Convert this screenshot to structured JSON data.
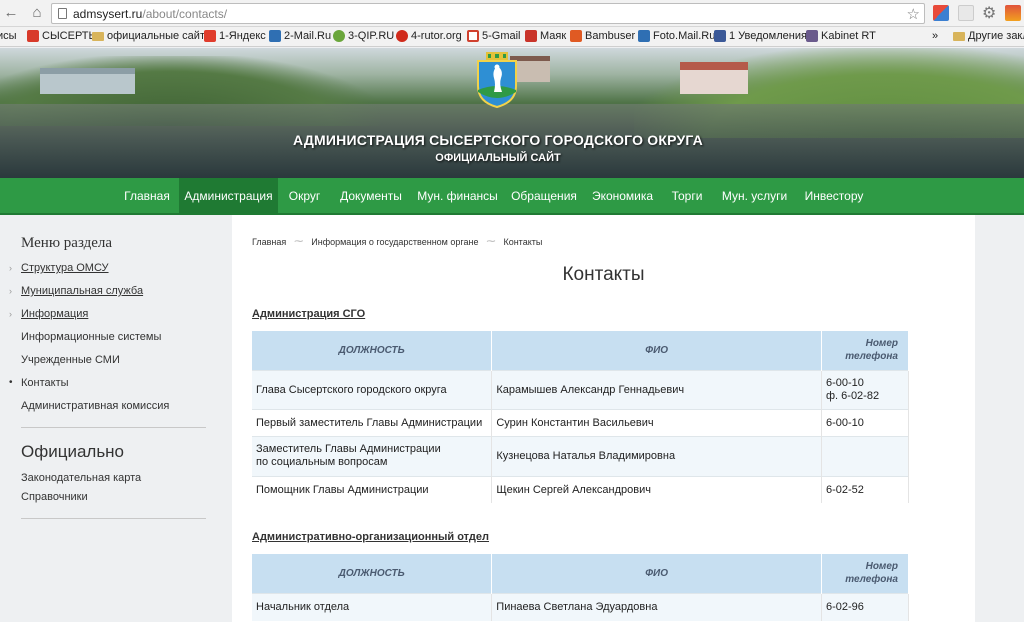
{
  "browser": {
    "url_host": "admsysert.ru",
    "url_path": "/about/contacts/",
    "bookmarks": [
      {
        "label": "исы",
        "color": "#ffffff"
      },
      {
        "label": "СЫСЕРТЬ",
        "color": "#d83a2a"
      },
      {
        "label": "официальные сайты",
        "color": "#d8b45b"
      },
      {
        "label": "1-Яндекс",
        "color": "#e03c2c"
      },
      {
        "label": "2-Mail.Ru",
        "color": "#2f6fb3"
      },
      {
        "label": "3-QIP.RU",
        "color": "#6aa63b"
      },
      {
        "label": "4-rutor.org",
        "color": "#d02a1b"
      },
      {
        "label": "5-Gmail",
        "color": "#d0402e"
      },
      {
        "label": "Маяк",
        "color": "#c9342a"
      },
      {
        "label": "Bambuser",
        "color": "#e05a23"
      },
      {
        "label": "Foto.Mail.Ru",
        "color": "#2f6fb3"
      },
      {
        "label": "1 Уведомления",
        "color": "#3b5998"
      },
      {
        "label": "Kabinet RT",
        "color": "#6a5a8c"
      },
      {
        "label": "»",
        "color": ""
      },
      {
        "label": "Другие закла",
        "color": "#d8b45b"
      }
    ]
  },
  "header": {
    "title": "АДМИНИСТРАЦИЯ СЫСЕРТСКОГО ГОРОДСКОГО ОКРУГА",
    "subtitle": "ОФИЦИАЛЬНЫЙ САЙТ"
  },
  "mainnav": [
    "Главная",
    "Администрация",
    "Округ",
    "Документы",
    "Мун. финансы",
    "Обращения",
    "Экономика",
    "Торги",
    "Мун. услуги",
    "Инвестору"
  ],
  "mainnav_active": "Администрация",
  "sidebar": {
    "section_title": "Меню раздела",
    "items": [
      {
        "label": "Структура ОМСУ"
      },
      {
        "label": "Муниципальная служба"
      },
      {
        "label": "Информация"
      },
      {
        "label": "Информационные системы"
      },
      {
        "label": "Учрежденные СМИ"
      },
      {
        "label": "Контакты"
      },
      {
        "label": "Административная комиссия"
      }
    ],
    "official_title": "Официально",
    "official_items": [
      "Законодательная карта",
      "Справочники"
    ]
  },
  "breadcrumb": [
    "Главная",
    "Информация о государственном органе",
    "Контакты"
  ],
  "page_title": "Контакты",
  "sections": [
    {
      "title": "Администрация СГО",
      "headers": [
        "ДОЛЖНОСТЬ",
        "ФИО",
        "Номер телефона"
      ],
      "rows": [
        [
          "Глава Сысертского городского округа",
          "Карамышев Александр Геннадьевич",
          "6-00-10\nф. 6-02-82"
        ],
        [
          "Первый заместитель Главы Администрации",
          "Сурин Константин Васильевич",
          "6-00-10"
        ],
        [
          "Заместитель Главы Администрации\nпо социальным вопросам",
          "Кузнецова Наталья Владимировна",
          ""
        ],
        [
          "Помощник Главы Администрации",
          "Щекин Сергей Александрович",
          "6-02-52"
        ]
      ]
    },
    {
      "title": "Административно-организационный отдел",
      "headers": [
        "ДОЛЖНОСТЬ",
        "ФИО",
        "Номер телефона"
      ],
      "rows": [
        [
          "Начальник отдела",
          "Пинаева Светлана Эдуардовна",
          "6-02-96"
        ]
      ]
    }
  ]
}
